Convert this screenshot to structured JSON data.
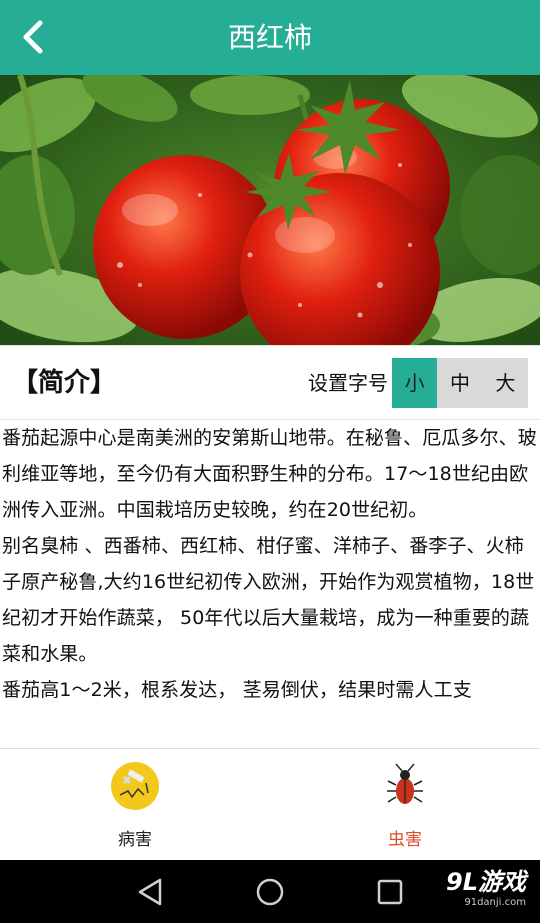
{
  "header": {
    "title": "西红柿",
    "back_icon": "chevron-left-icon"
  },
  "intro": {
    "title": "【简介】",
    "font_size_label": "设置字号",
    "font_sizes": [
      "小",
      "中",
      "大"
    ],
    "selected_font_size": "小"
  },
  "content": {
    "paragraphs": [
      "番茄起源中心是南美洲的安第斯山地带。在秘鲁、厄瓜多尔、玻利维亚等地，至今仍有大面积野生种的分布。17～18世纪由欧洲传入亚洲。中国栽培历史较晚，约在20世纪初。",
      "别名臭柿 、西番柿、西红柿、柑仔蜜、洋柿子、番李子、火柿子原产秘鲁,大约16世纪初传入欧洲，开始作为观赏植物，18世纪初才开始作蔬菜， 50年代以后大量栽培，成为一种重要的蔬菜和水果。",
      "番茄高1～2米，根系发达， 茎易倒伏，结果时需人工支"
    ]
  },
  "tabs": [
    {
      "label": "病害",
      "icon": "disease-icon"
    },
    {
      "label": "虫害",
      "icon": "bug-icon"
    }
  ],
  "system_nav": {
    "icons": [
      "back-triangle-icon",
      "home-circle-icon",
      "recents-square-icon"
    ]
  },
  "watermark": {
    "main": "9L游戏",
    "sub": "91danji.com"
  },
  "colors": {
    "accent": "#26ad96",
    "pest_label": "#e04b2c"
  }
}
